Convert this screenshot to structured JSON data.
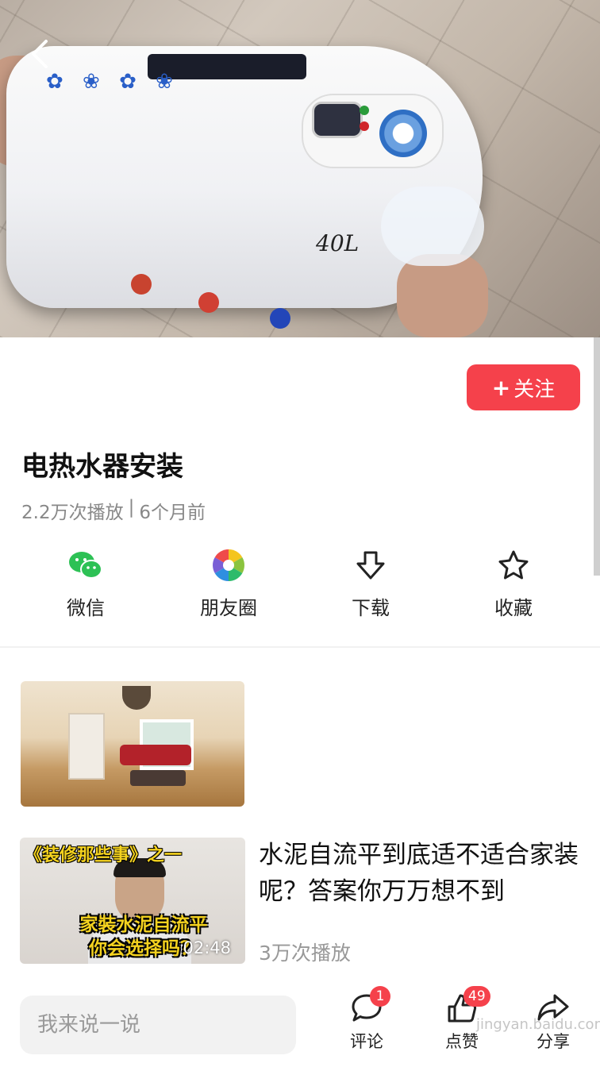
{
  "video": {
    "capacity_label": "40L"
  },
  "header": {
    "back_icon": "chevron-left-icon"
  },
  "info": {
    "follow_plus": "+",
    "follow_label": "关注",
    "title": "电热水器安装",
    "plays": "2.2万次播放",
    "separator": "|",
    "time_ago": "6个月前"
  },
  "share": [
    {
      "label": "微信",
      "icon": "wechat-icon"
    },
    {
      "label": "朋友圈",
      "icon": "moments-icon"
    },
    {
      "label": "下载",
      "icon": "download-icon"
    },
    {
      "label": "收藏",
      "icon": "star-icon"
    }
  ],
  "related": {
    "thumb2_caption_top": "《装修那些事》之一",
    "thumb2_caption_line1": "家裝水泥自流平",
    "thumb2_caption_line2": "你会选择吗？",
    "duration": "02:48",
    "title": "水泥自流平到底适不适合家装呢？答案你万万想不到",
    "plays": "3万次播放"
  },
  "bottom_bar": {
    "comment_placeholder": "我来说一说",
    "comment_label": "评论",
    "comment_count": "1",
    "like_label": "点赞",
    "like_count": "49",
    "share_label": "分享"
  },
  "watermark": "jingyan.baidu.com",
  "colors": {
    "accent": "#f5414b",
    "wechat": "#2dc155",
    "text_secondary": "#888888"
  }
}
